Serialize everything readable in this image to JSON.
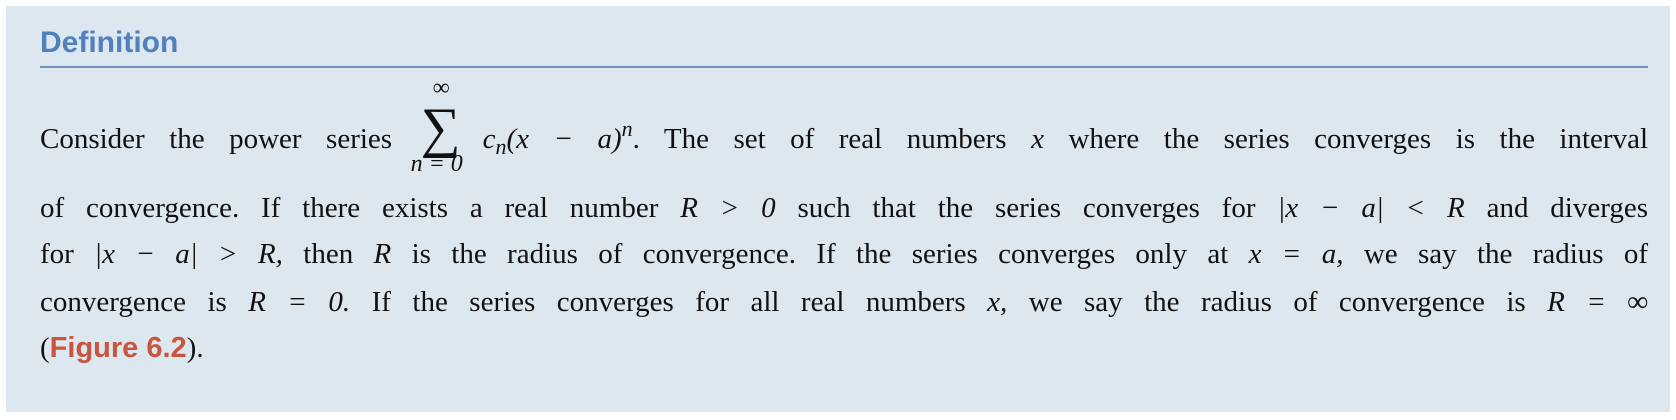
{
  "definition": {
    "title": "Definition",
    "line1": {
      "pre": "Consider the power series",
      "sum_upper": "∞",
      "sum_symbol": "∑",
      "sum_lower": "n = 0",
      "term_c": "c",
      "term_sub": "n",
      "term_paren": "(x − a)",
      "term_sup": "n",
      "after": ".  The set of real numbers",
      "var_x": "x",
      "post": "where the series converges is the interval"
    },
    "line2": {
      "pre": "of convergence. If there exists a real number",
      "expr1": "R > 0",
      "mid": "such that the series converges for",
      "expr2": "|x − a| < R",
      "post": "and diverges"
    },
    "line3": {
      "pre": "for",
      "expr1": "|x − a| > R,",
      "mid1": "then",
      "var_r": "R",
      "mid2": "is the radius of convergence. If the series converges only at",
      "expr2": "x = a,",
      "post": "we say the radius of"
    },
    "line4": {
      "pre": "convergence is",
      "expr1": "R = 0.",
      "mid": "If the series converges for all real numbers",
      "var_x": "x,",
      "mid2": "we say the radius of convergence is",
      "expr2": "R = ∞"
    },
    "line5": {
      "open": "(",
      "link": "Figure 6.2",
      "close": ")."
    }
  }
}
